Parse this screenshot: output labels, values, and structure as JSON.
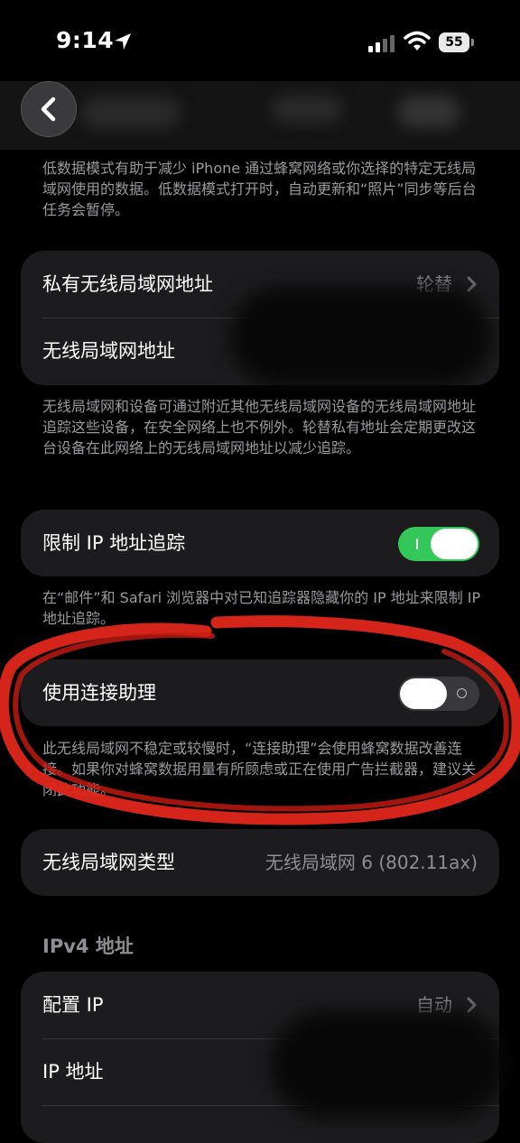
{
  "status_bar": {
    "time": "9:14",
    "battery": "55"
  },
  "nav": {
    "back_icon": "chevron-left-icon"
  },
  "low_data_footer": "低数据模式有助于减少 iPhone 通过蜂窝网络或你选择的特定无线局域网使用的数据。低数据模式打开时，自动更新和“照片”同步等后台任务会暂停。",
  "wifi_address_group": {
    "rows": [
      {
        "label": "私有无线局域网地址",
        "value": "轮替"
      },
      {
        "label": "无线局域网地址"
      }
    ]
  },
  "wifi_address_footer": "无线局域网和设备可通过附近其他无线局域网设备的无线局域网地址追踪这些设备，在安全网络上也不例外。轮替私有地址会定期更改这台设备在此网络上的无线局域网地址以减少追踪。",
  "ip_tracking": {
    "label": "限制 IP 地址追踪",
    "enabled": true
  },
  "ip_tracking_footer": "在“邮件”和 Safari 浏览器中对已知追踪器隐藏你的 IP 地址来限制 IP 地址追踪。",
  "connection_assistant": {
    "label": "使用连接助理",
    "enabled": false
  },
  "connection_assistant_footer": "此无线局域网不稳定或较慢时，“连接助理”会使用蜂窝数据改善连接。如果你对蜂窝数据用量有所顾虑或正在使用广告拦截器，建议关闭此功能。",
  "wifi_type": {
    "label": "无线局域网类型",
    "value": "无线局域网 6 (802.11ax)"
  },
  "ipv4_header": "IPv4 地址",
  "ipv4_group": {
    "rows": [
      {
        "label": "配置 IP",
        "value": "自动"
      },
      {
        "label": "IP 地址"
      }
    ]
  },
  "colors": {
    "toggle_on": "#34c759",
    "annotation": "#e0261b"
  }
}
